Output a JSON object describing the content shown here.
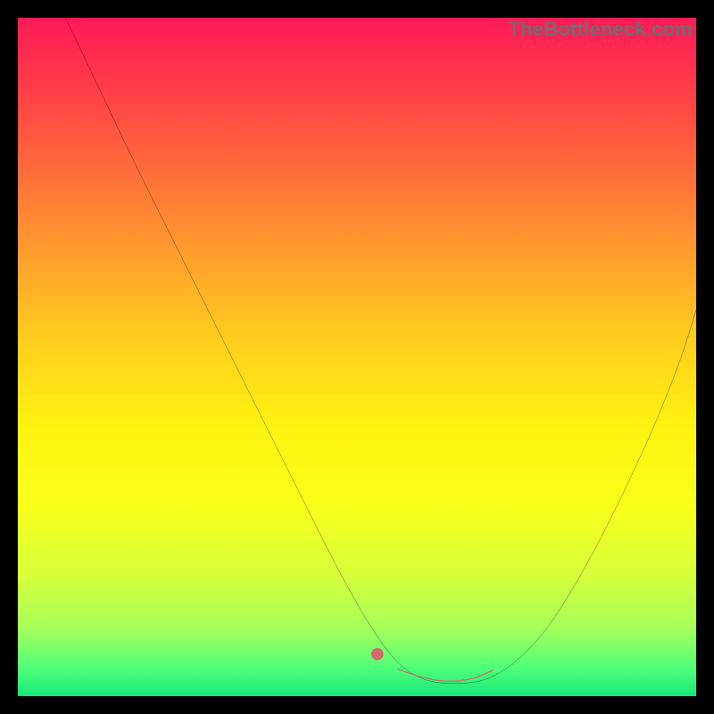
{
  "watermark": "TheBottleneck.com",
  "chart_data": {
    "type": "line",
    "title": "",
    "xlabel": "",
    "ylabel": "",
    "xlim": [
      0,
      100
    ],
    "ylim": [
      0,
      100
    ],
    "grid": false,
    "background_gradient": {
      "orientation": "vertical",
      "stops": [
        {
          "pos": 0.0,
          "color": "#ff1a58"
        },
        {
          "pos": 0.5,
          "color": "#ffd015"
        },
        {
          "pos": 0.8,
          "color": "#f5ff20"
        },
        {
          "pos": 1.0,
          "color": "#19e77a"
        }
      ]
    },
    "series": [
      {
        "name": "curve",
        "color": "#000000",
        "stroke_width": 2,
        "x": [
          7,
          12,
          17,
          22,
          27,
          32,
          37,
          42,
          47,
          52,
          56,
          60,
          64,
          68,
          72,
          76,
          80,
          84,
          88,
          92,
          96,
          100
        ],
        "y": [
          100,
          89,
          79,
          69,
          59,
          49,
          40,
          31,
          22,
          14,
          8,
          4,
          1,
          1,
          3,
          7,
          13,
          20,
          28,
          37,
          47,
          57
        ]
      },
      {
        "name": "highlight-flat",
        "color": "#d46a6a",
        "stroke_width": 9,
        "cap": "round",
        "x": [
          56,
          58,
          60,
          62,
          64,
          66,
          68,
          70
        ],
        "y": [
          2.7,
          2.4,
          2.2,
          2.1,
          2.1,
          2.2,
          2.4,
          2.8
        ]
      },
      {
        "name": "highlight-dot",
        "type": "scatter",
        "color": "#d46a6a",
        "radius": 6,
        "x": [
          53
        ],
        "y": [
          5.2
        ]
      }
    ]
  }
}
